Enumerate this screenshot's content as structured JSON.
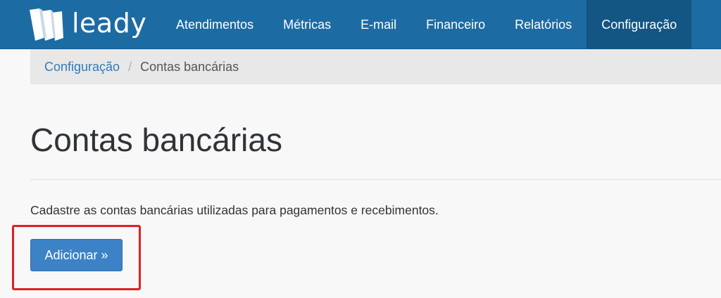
{
  "brand": {
    "name": "leady",
    "logo_icon": "leady-logo-icon"
  },
  "nav": {
    "items": [
      {
        "label": "Atendimentos",
        "active": false
      },
      {
        "label": "Métricas",
        "active": false
      },
      {
        "label": "E-mail",
        "active": false
      },
      {
        "label": "Financeiro",
        "active": false
      },
      {
        "label": "Relatórios",
        "active": false
      },
      {
        "label": "Configuração",
        "active": true
      }
    ]
  },
  "breadcrumb": {
    "parent": "Configuração",
    "separator": "/",
    "current": "Contas bancárias"
  },
  "page": {
    "title": "Contas bancárias",
    "description": "Cadastre as contas bancárias utilizadas para pagamentos e recebimentos.",
    "add_button_label": "Adicionar »"
  },
  "colors": {
    "navbar": "#1d6ba3",
    "nav_active": "#135583",
    "primary_button": "#3c82c6",
    "link": "#337ab7",
    "highlight": "#e01e24"
  }
}
